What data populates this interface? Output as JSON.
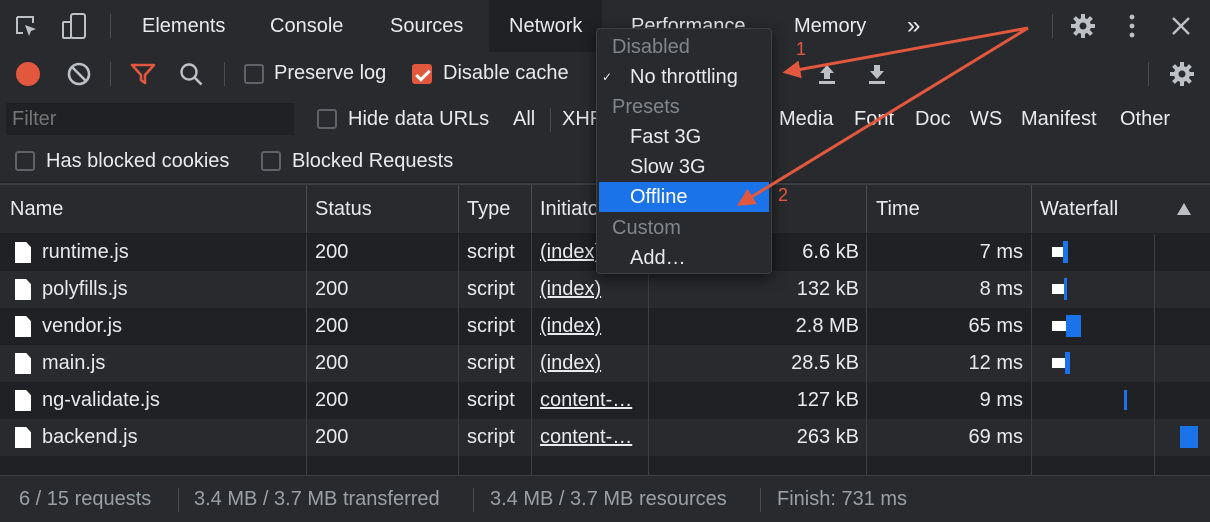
{
  "tabs": [
    "Elements",
    "Console",
    "Sources",
    "Network",
    "Performance",
    "Memory"
  ],
  "tabs_more": "»",
  "toolbar": {
    "preserve_log": "Preserve log",
    "disable_cache": "Disable cache",
    "disable_cache_checked": true
  },
  "filter": {
    "placeholder": "Filter",
    "hide_data_urls": "Hide data URLs",
    "types": [
      "All",
      "XHR",
      "Media",
      "Font",
      "Doc",
      "WS",
      "Manifest",
      "Other"
    ],
    "has_blocked_cookies": "Has blocked cookies",
    "blocked_requests": "Blocked Requests"
  },
  "table": {
    "headers": {
      "name": "Name",
      "status": "Status",
      "type": "Type",
      "initiator": "Initiator",
      "time": "Time",
      "waterfall": "Waterfall"
    },
    "rows": [
      {
        "name": "runtime.js",
        "status": "200",
        "type": "script",
        "initiator": "(index)",
        "size": "6.6 kB",
        "time": "7 ms"
      },
      {
        "name": "polyfills.js",
        "status": "200",
        "type": "script",
        "initiator": "(index)",
        "size": "132 kB",
        "time": "8 ms"
      },
      {
        "name": "vendor.js",
        "status": "200",
        "type": "script",
        "initiator": "(index)",
        "size": "2.8 MB",
        "time": "65 ms"
      },
      {
        "name": "main.js",
        "status": "200",
        "type": "script",
        "initiator": "(index)",
        "size": "28.5 kB",
        "time": "12 ms"
      },
      {
        "name": "ng-validate.js",
        "status": "200",
        "type": "script",
        "initiator": "content-…",
        "size": "127 kB",
        "time": "9 ms"
      },
      {
        "name": "backend.js",
        "status": "200",
        "type": "script",
        "initiator": "content-…",
        "size": "263 kB",
        "time": "69 ms"
      }
    ]
  },
  "status": {
    "requests": "6 / 15 requests",
    "transferred": "3.4 MB / 3.7 MB transferred",
    "resources": "3.4 MB / 3.7 MB resources",
    "finish": "Finish: 731 ms"
  },
  "throttling_menu": {
    "group_disabled": "Disabled",
    "no_throttling": "No throttling",
    "group_presets": "Presets",
    "fast3g": "Fast 3G",
    "slow3g": "Slow 3G",
    "offline": "Offline",
    "group_custom": "Custom",
    "add": "Add…",
    "check": "✓"
  },
  "annotations": {
    "one": "1",
    "two": "2"
  },
  "colors": {
    "accent": "#1a73e8",
    "record": "#e2583e",
    "annotation": "#e2583e"
  }
}
